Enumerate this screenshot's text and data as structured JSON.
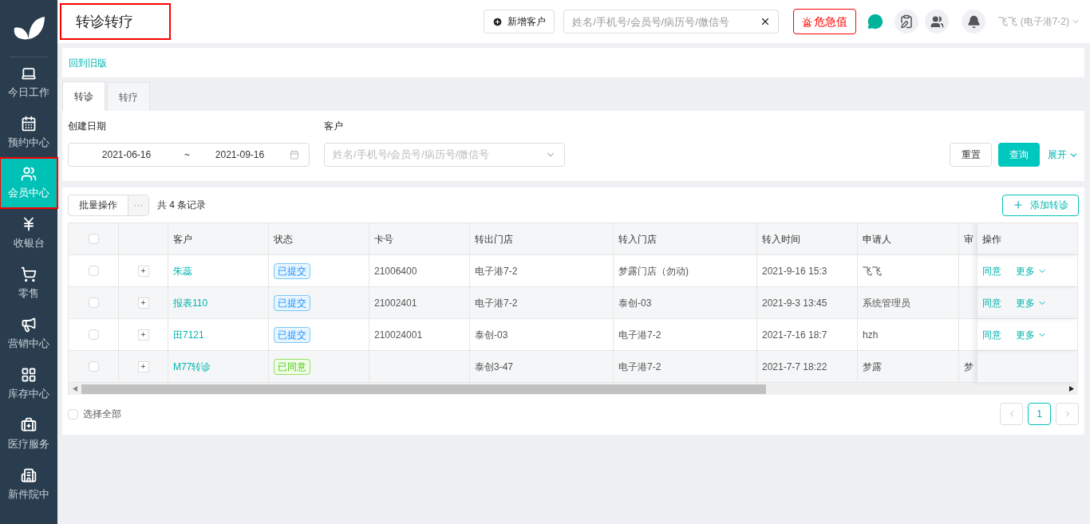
{
  "sidebar": {
    "items": [
      {
        "label": "今日工作",
        "selected": false,
        "highlighted": false
      },
      {
        "label": "预约中心",
        "selected": false,
        "highlighted": false
      },
      {
        "label": "会员中心",
        "selected": true,
        "highlighted": true
      },
      {
        "label": "收银台",
        "selected": false,
        "highlighted": false
      },
      {
        "label": "零售",
        "selected": false,
        "highlighted": false
      },
      {
        "label": "营销中心",
        "selected": false,
        "highlighted": false
      },
      {
        "label": "库存中心",
        "selected": false,
        "highlighted": false
      },
      {
        "label": "医疗服务",
        "selected": false,
        "highlighted": false
      },
      {
        "label": "新件院中",
        "selected": false,
        "highlighted": false
      }
    ]
  },
  "header": {
    "title": "转诊转疗",
    "title_highlighted": true,
    "new_customer": "新增客户",
    "search": {
      "placeholder": "姓名/手机号/会员号/病历号/微信号"
    },
    "alert": "危急值",
    "user": "飞飞 (电子港7-2)"
  },
  "back_link": "回到旧版",
  "tabs": [
    {
      "label": "转诊",
      "selected": true
    },
    {
      "label": "转疗",
      "selected": false
    }
  ],
  "filters": {
    "date_label": "创建日期",
    "date_from": "2021-06-16",
    "date_sep": "~",
    "date_to": "2021-09-16",
    "customer_label": "客户",
    "customer_placeholder": "姓名/手机号/会员号/病历号/微信号",
    "reset": "重置",
    "query": "查询",
    "expand": "展开"
  },
  "toolbar": {
    "batch": "批量操作",
    "more": "···",
    "count": "共 4 条记录",
    "add": "添加转诊"
  },
  "table": {
    "header_checked": false,
    "columns": [
      "客户",
      "状态",
      "卡号",
      "转出门店",
      "转入门店",
      "转入时间",
      "申请人",
      "审",
      "操作"
    ],
    "rows": [
      {
        "checked": false,
        "expand": "+",
        "customer": "朱蕊",
        "status": "已提交",
        "kind": "submitted",
        "card": "21006400",
        "from": "电子港7-2",
        "to": "梦露门店（勿动)",
        "time": "2021-9-16 15:3",
        "applicant": "飞飞",
        "actions": [
          "同意",
          "更多"
        ]
      },
      {
        "checked": false,
        "expand": "+",
        "customer": "报表110",
        "status": "已提交",
        "kind": "submitted",
        "card": "21002401",
        "from": "电子港7-2",
        "to": "泰创-03",
        "time": "2021-9-3 13:45",
        "applicant": "系统管理员",
        "actions": [
          "同意",
          "更多"
        ]
      },
      {
        "checked": false,
        "expand": "+",
        "customer": "田7121",
        "status": "已提交",
        "kind": "submitted",
        "card": "210024001",
        "from": "泰创-03",
        "to": "电子港7-2",
        "time": "2021-7-16 18:7",
        "applicant": "hzh",
        "actions": [
          "同意",
          "更多"
        ]
      },
      {
        "checked": false,
        "expand": "+",
        "customer": "M77转诊",
        "status": "已同意",
        "kind": "agreed",
        "from": "泰创3-47",
        "to": "电子港7-2",
        "time": "2021-7-7 18:22",
        "applicant": "梦露",
        "approver": "梦"
      }
    ]
  },
  "select_all": {
    "label": "选择全部",
    "checked": false
  },
  "pagination": [
    {
      "label": "1",
      "selected": true
    }
  ]
}
